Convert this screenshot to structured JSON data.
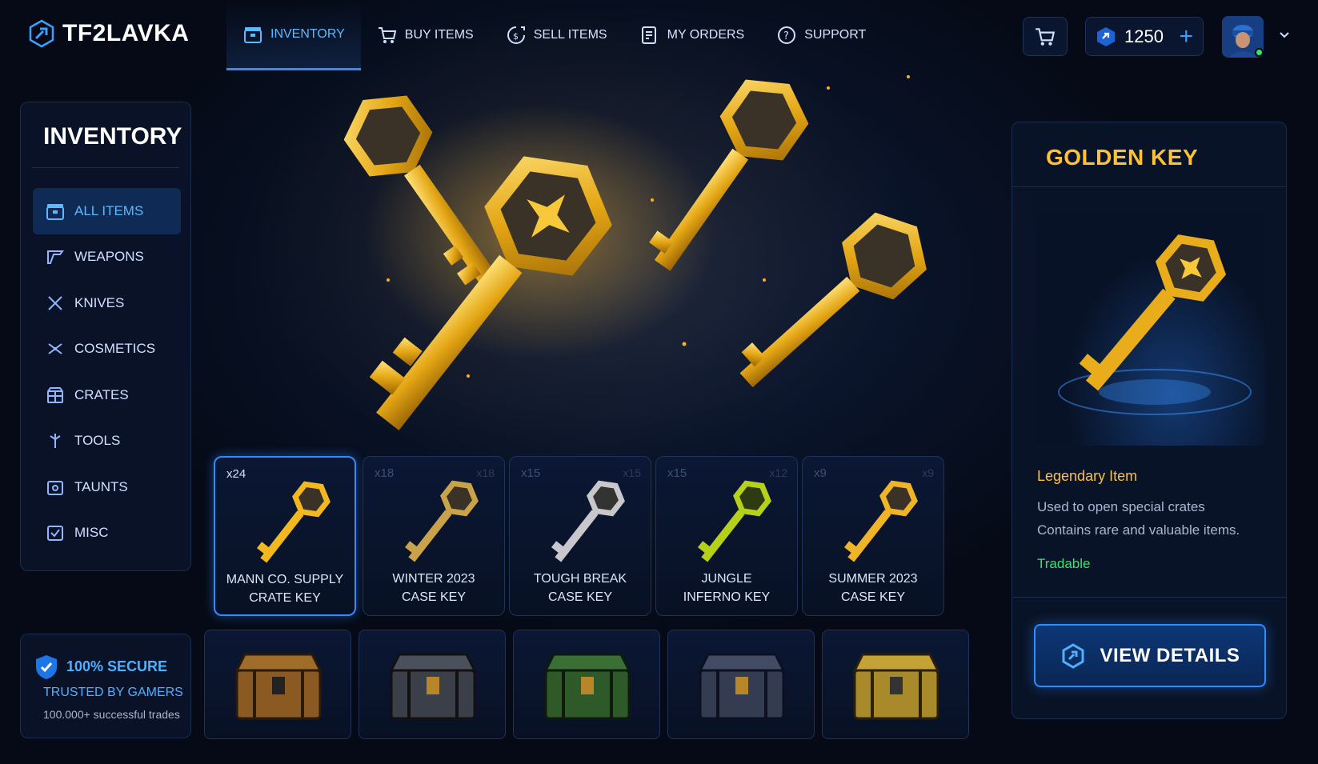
{
  "brand": {
    "name": "TF2LAVKA"
  },
  "nav": [
    {
      "label": "INVENTORY",
      "icon": "inventory-icon",
      "active": true
    },
    {
      "label": "BUY ITEMS",
      "icon": "cart-icon"
    },
    {
      "label": "SELL ITEMS",
      "icon": "sell-icon"
    },
    {
      "label": "MY ORDERS",
      "icon": "orders-icon"
    },
    {
      "label": "SUPPORT",
      "icon": "help-icon"
    }
  ],
  "account": {
    "balance": "1250",
    "add_label": "+",
    "status": "online"
  },
  "sidebar": {
    "title": "INVENTORY",
    "items": [
      {
        "label": "ALL ITEMS",
        "icon": "all-items-icon",
        "active": true
      },
      {
        "label": "WEAPONS",
        "icon": "weapons-icon"
      },
      {
        "label": "KNIVES",
        "icon": "knives-icon"
      },
      {
        "label": "COSMETICS",
        "icon": "cosmetics-icon"
      },
      {
        "label": "CRATES",
        "icon": "crates-icon"
      },
      {
        "label": "TOOLS",
        "icon": "tools-icon"
      },
      {
        "label": "TAUNTS",
        "icon": "taunts-icon"
      },
      {
        "label": "MISC",
        "icon": "misc-icon"
      }
    ]
  },
  "secure": {
    "title": "100% SECURE",
    "subtitle": "TRUSTED BY GAMERS",
    "note": "100.000+ successful trades"
  },
  "items": [
    {
      "qty": "x24",
      "qty2": "",
      "line1": "MANN CO. SUPPLY",
      "line2": "CRATE KEY",
      "color": "#f2b81e",
      "selected": true
    },
    {
      "qty": "x18",
      "qty2": "x18",
      "line1": "WINTER 2023",
      "line2": "CASE KEY",
      "color": "#c9a24a"
    },
    {
      "qty": "x15",
      "qty2": "x15",
      "line1": "TOUGH BREAK",
      "line2": "CASE KEY",
      "color": "#c8c8cc"
    },
    {
      "qty": "x15",
      "qty2": "x12",
      "line1": "JUNGLE",
      "line2": "INFERNO KEY",
      "color": "#b6d11a"
    },
    {
      "qty": "x9",
      "qty2": "x9",
      "line1": "SUMMER 2023",
      "line2": "CASE KEY",
      "color": "#f0b428"
    }
  ],
  "crates": [
    {
      "name": "brown-crate",
      "color": "#8a5a22"
    },
    {
      "name": "dark-crate",
      "color": "#3a3f4a"
    },
    {
      "name": "green-crate",
      "color": "#2e5a2a"
    },
    {
      "name": "steel-crate",
      "color": "#343c52"
    },
    {
      "name": "gold-crate",
      "color": "#a88a2a"
    }
  ],
  "detail": {
    "title": "GOLDEN KEY",
    "rarity": "Legendary Item",
    "desc1": "Used to open special crates",
    "desc2": "Contains rare and valuable items.",
    "tradable": "Tradable",
    "button": "VIEW DETAILS"
  },
  "colors": {
    "accent": "#2f8cff",
    "gold": "#ffc233",
    "green": "#2ee86a",
    "bg": "#050a16"
  }
}
